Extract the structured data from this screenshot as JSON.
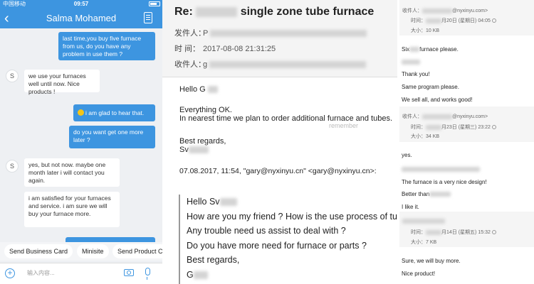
{
  "chat": {
    "status": {
      "carrier": "中国移动",
      "time": "09:57"
    },
    "header": {
      "title": "Salma Mohamed"
    },
    "messages": [
      {
        "text": "last time,you buy five furnace from us, do you have any problem in use them ?"
      },
      {
        "avatar": "S",
        "text": "we use your furnaces well until now. Nice products !"
      },
      {
        "text": "i am glad to hear that."
      },
      {
        "text": "do you want get one more later ?"
      },
      {
        "avatar": "S",
        "text": "yes, but not now. maybe one month later i will contact you again."
      },
      {
        "text": "i am satisfied for your furnaces and service. i am sure we will buy your furnace more."
      }
    ],
    "quick_replies": [
      "Send Business Card",
      "Minisite",
      "Send Product C"
    ],
    "input_placeholder": "输入内容..."
  },
  "email": {
    "subject_prefix": "Re:",
    "subject_suffix": "single zone tube furnace",
    "sender_label": "发件人：",
    "sender_value": "P",
    "time_label": "时    间：",
    "time_value": "2017-08-08 21:31:25",
    "recipient_label": "收件人：",
    "recipient_value": "g",
    "body": {
      "greeting": "Hello G",
      "line1": "Everything OK.",
      "line2": "In nearest time we plan to order additional furnace and tubes.",
      "line3": "remember",
      "closing": "Best regards,",
      "signature": "Sv",
      "quote_header": "07.08.2017, 11:54, \"gary@nyxinyu.cn\" <gary@nyxinyu.cn>:",
      "quote_lines": [
        "Hello Sv",
        "How are you my friend ? How is the use process of tube",
        "Any trouble need us assist to deal with ?",
        "Do you have more need for furnace or parts ?",
        "Best regards,",
        "G"
      ]
    }
  },
  "thread": {
    "meta1": {
      "recipient": "收件人：",
      "recipient_email": "@nyxinyu.com>",
      "time": "时间：",
      "date": "月20日 (星期日) 04:05",
      "size": "大小：10 KB"
    },
    "block1": [
      "Six",
      "furnace please.",
      "Thank you!",
      "Same program please.",
      "We sell all, and works good!"
    ],
    "meta2": {
      "recipient": "收件人：",
      "recipient_email": "@nyxinyu.com>",
      "time": "时间：",
      "date": "月23日 (星期三) 23:22",
      "size": "大小：34 KB"
    },
    "block2": [
      "yes.",
      "The furnace is a very nice design!",
      "Better than",
      "I like it."
    ],
    "meta3": {
      "time": "时间：",
      "date": "月14日 (星期五) 15:32",
      "size": "大小：7 KB"
    },
    "block3": [
      "Sure, we will buy more.",
      "Nice product!"
    ]
  }
}
